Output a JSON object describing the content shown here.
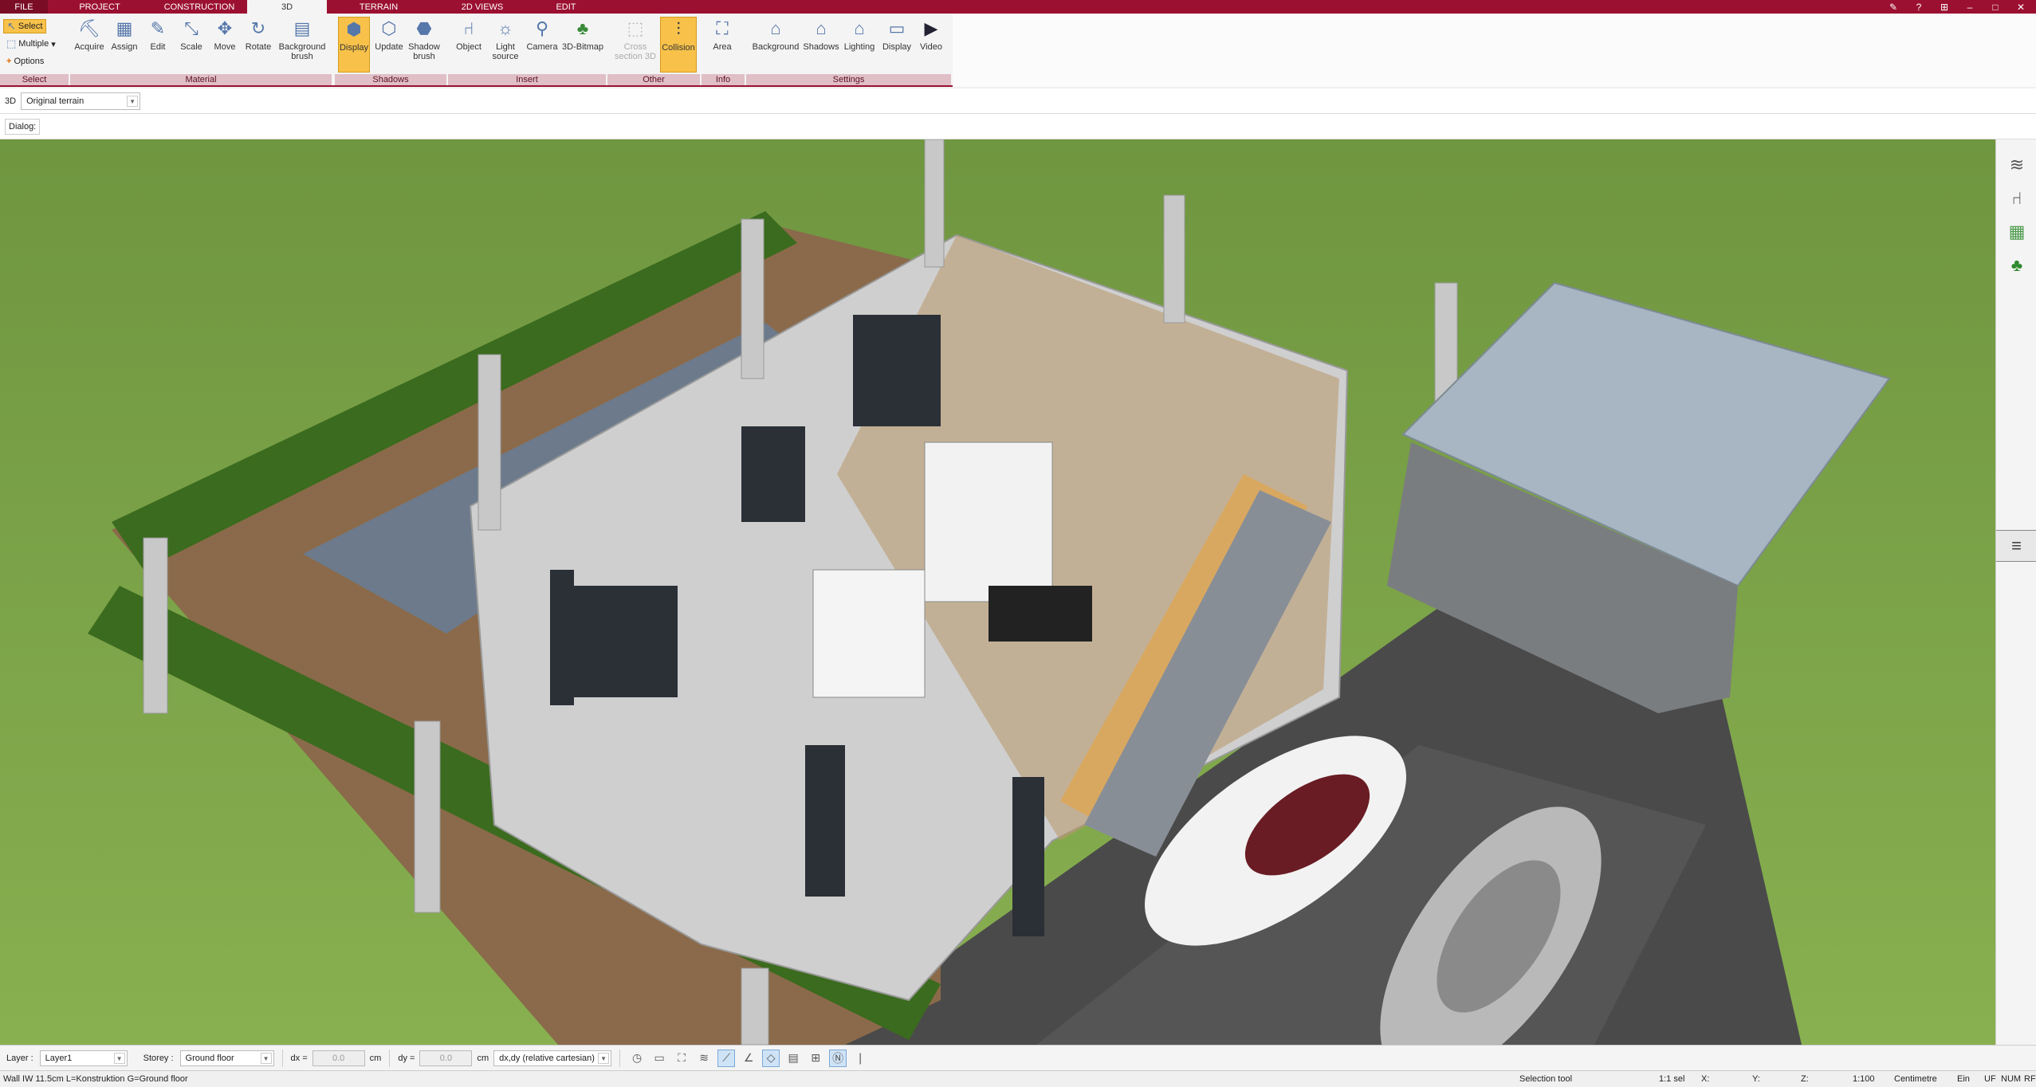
{
  "tabs": [
    "FILE",
    "PROJECT",
    "CONSTRUCTION",
    "3D",
    "TERRAIN",
    "2D VIEWS",
    "EDIT"
  ],
  "active_tab": "3D",
  "ribbon": {
    "select_group": {
      "label": "Select",
      "select": "Select",
      "multiple": "Multiple",
      "options": "Options"
    },
    "material_group": {
      "label": "Material",
      "buttons": [
        "Acquire",
        "Assign",
        "Edit",
        "Scale",
        "Move",
        "Rotate",
        "Background brush"
      ]
    },
    "shadows_group": {
      "label": "Shadows",
      "buttons": [
        "Display",
        "Update",
        "Shadow brush"
      ]
    },
    "insert_group": {
      "label": "Insert",
      "buttons": [
        "Object",
        "Light source",
        "Camera",
        "3D-Bitmap"
      ]
    },
    "other_group": {
      "label": "Other",
      "buttons": [
        "Cross section 3D",
        "Collision"
      ]
    },
    "info_group": {
      "label": "Info",
      "buttons": [
        "Area"
      ]
    },
    "settings_group": {
      "label": "Settings",
      "buttons": [
        "Background",
        "Shadows",
        "Lighting",
        "Display",
        "Video"
      ]
    }
  },
  "subbar": {
    "mode": "3D",
    "terrain": "Original terrain"
  },
  "dialog": {
    "label": "Dialog:"
  },
  "bottombar": {
    "layer_label": "Layer :",
    "layer_value": "Layer1",
    "storey_label": "Storey :",
    "storey_value": "Ground floor",
    "dx_label": "dx =",
    "dx_value": "0.0",
    "dx_unit": "cm",
    "dy_label": "dy =",
    "dy_value": "0.0",
    "dy_unit": "cm",
    "coord_mode": "dx,dy (relative cartesian)"
  },
  "status": {
    "info": "Wall IW 11.5cm L=Konstruktion G=Ground floor",
    "tool": "Selection tool",
    "sel": "1:1 sel",
    "x": "X:",
    "y": "Y:",
    "z": "Z:",
    "scale": "1:100",
    "unit": "Centimetre",
    "ein": "Ein",
    "uf": "UF",
    "num": "NUM",
    "rf": "RF"
  },
  "colors": {
    "accent": "#9b1030",
    "ribbon_group": "#e0bfc7",
    "active": "#f8c24a",
    "grass": "#7aa046"
  }
}
